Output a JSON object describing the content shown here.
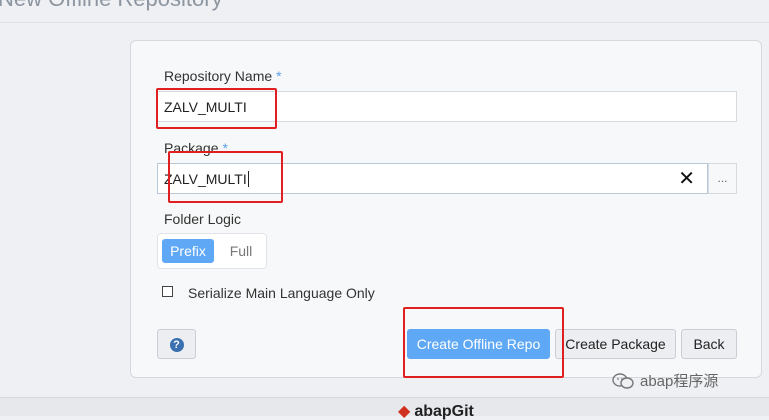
{
  "page": {
    "title": "New Offline Repository"
  },
  "form": {
    "repo_name_label": "Repository Name",
    "required_mark": "*",
    "repo_name_value": "ZALV_MULTI",
    "package_label": "Package",
    "package_value": "ZALV_MULTI",
    "browse_label": "...",
    "folder_logic_label": "Folder Logic",
    "folder_logic_options": [
      "Prefix",
      "Full"
    ],
    "folder_logic_selected": "Prefix",
    "serialize_label": "Serialize Main Language Only",
    "serialize_checked": false
  },
  "buttons": {
    "help": "?",
    "create_offline_repo": "Create Offline Repo",
    "create_package": "Create Package",
    "back": "Back"
  },
  "footer": {
    "logo_text": "abapGit"
  },
  "watermark": {
    "text": "abap程序源"
  },
  "colors": {
    "accent": "#5fa8f5",
    "highlight": "#e02020",
    "required": "#5a9fe8"
  }
}
